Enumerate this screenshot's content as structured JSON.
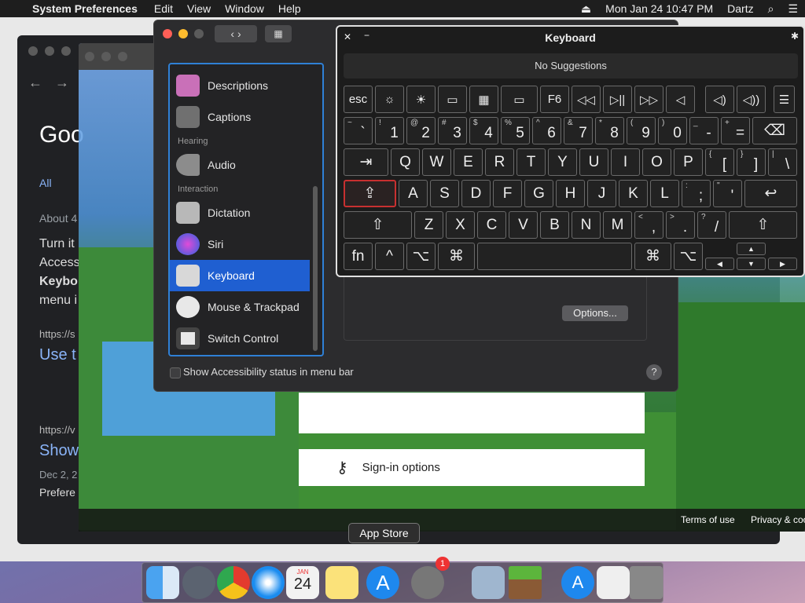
{
  "menubar": {
    "app_name": "System Preferences",
    "menus": [
      "Edit",
      "View",
      "Window",
      "Help"
    ],
    "datetime": "Mon Jan 24  10:47 PM",
    "user": "Dartz"
  },
  "browser": {
    "logo": "Goo",
    "tab_all": "All",
    "about": "About 4",
    "lines": [
      "Turn it",
      "Access",
      "Keybo",
      "menu i"
    ],
    "url1": "https://s",
    "link1": "Use t",
    "url2": "https://v",
    "link2": "Show",
    "date": "Dec 2, 2",
    "prefs_snip": "Prefere"
  },
  "game": {
    "signin_label": "Sign-in options",
    "terms": "Terms of use",
    "privacy": "Privacy & coo"
  },
  "prefs": {
    "sidebar": {
      "items": [
        {
          "label": "Descriptions"
        },
        {
          "label": "Captions"
        },
        {
          "label": "Audio"
        },
        {
          "label": "Dictation"
        },
        {
          "label": "Siri"
        },
        {
          "label": "Keyboard"
        },
        {
          "label": "Mouse & Trackpad"
        },
        {
          "label": "Switch Control"
        }
      ],
      "headers": [
        "Hearing",
        "Interaction"
      ]
    },
    "options_button": "Options...",
    "status_checkbox": "Show Accessibility status in menu bar",
    "help": "?"
  },
  "keyboard": {
    "title": "Keyboard",
    "suggestions": "No Suggestions",
    "row_fn": [
      "esc",
      "☼",
      "☀",
      "▭",
      "▦",
      "▭",
      "F6",
      "◁◁",
      "▷||",
      "▷▷",
      "◁",
      "◁)",
      "◁))",
      "☰"
    ],
    "row_num": [
      [
        "~",
        "`"
      ],
      [
        "!",
        "1"
      ],
      [
        "@",
        "2"
      ],
      [
        "#",
        "3"
      ],
      [
        "$",
        "4"
      ],
      [
        "%",
        "5"
      ],
      [
        "^",
        "6"
      ],
      [
        "&",
        "7"
      ],
      [
        "*",
        "8"
      ],
      [
        "(",
        "9"
      ],
      [
        ")",
        "0"
      ],
      [
        "_",
        "-"
      ],
      [
        "+",
        "="
      ]
    ],
    "backspace": "⌫",
    "tab": "⇥",
    "row_q": [
      "Q",
      "W",
      "E",
      "R",
      "T",
      "Y",
      "U",
      "I",
      "O",
      "P"
    ],
    "row_q_brackets": [
      [
        "{",
        "["
      ],
      [
        "}",
        "]"
      ],
      [
        "|",
        "\\"
      ]
    ],
    "caps": "⇪",
    "row_a": [
      "A",
      "S",
      "D",
      "F",
      "G",
      "H",
      "J",
      "K",
      "L"
    ],
    "row_a_punct": [
      [
        ":",
        ";"
      ],
      [
        "\"",
        "'"
      ]
    ],
    "return": "↩",
    "shift": "⇧",
    "row_z": [
      "Z",
      "X",
      "C",
      "V",
      "B",
      "N",
      "M"
    ],
    "row_z_punct": [
      [
        "<",
        ","
      ],
      [
        ">",
        "."
      ],
      [
        "?",
        "/"
      ]
    ],
    "fn": "fn",
    "ctrl": "^",
    "opt": "⌥",
    "cmd": "⌘",
    "arrows": [
      "▲",
      "◀",
      "▼",
      "▶"
    ]
  },
  "dock": {
    "tooltip": "App Store",
    "calendar_month": "JAN",
    "calendar_day": "24",
    "badge": "1"
  }
}
